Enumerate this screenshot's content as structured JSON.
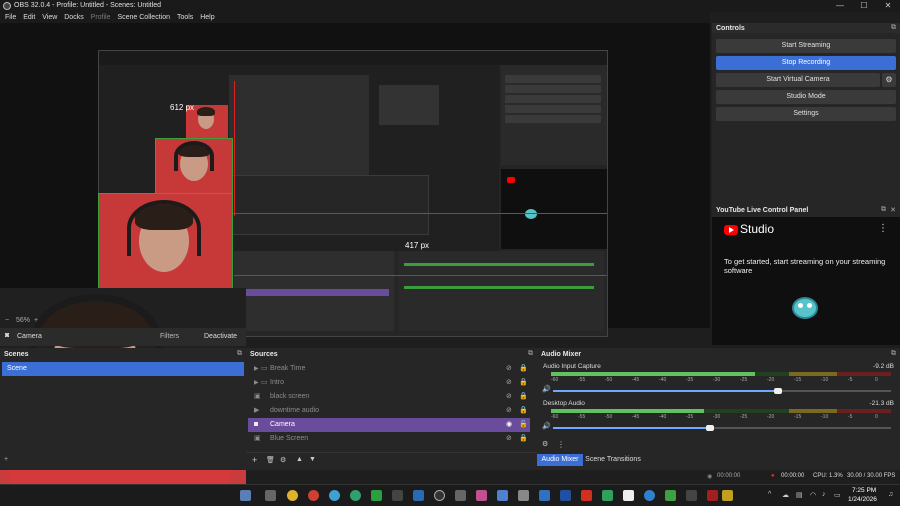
{
  "window": {
    "title": "OBS 32.0.4 - Profile: Untitled - Scenes: Untitled",
    "controls": [
      "—",
      "☐",
      "✕"
    ]
  },
  "menu": [
    "File",
    "Edit",
    "View",
    "Docks",
    "Profile",
    "Scene Collection",
    "Tools",
    "Help"
  ],
  "preview": {
    "size_label": "612 px",
    "size_label_2": "417 px",
    "zoom": "56%"
  },
  "controls_dock": {
    "title": "Controls",
    "start_streaming": "Start Streaming",
    "stop_recording": "Stop Recording",
    "start_virtual_camera": "Start Virtual Camera",
    "studio_mode": "Studio Mode",
    "settings": "Settings"
  },
  "youtube_dock": {
    "title": "YouTube Live Control Panel",
    "logo_text": "Studio",
    "message": "To get started, start streaming on your streaming software"
  },
  "source_toolbar": {
    "source_name": "Camera",
    "filters": "Filters",
    "deactivate": "Deactivate"
  },
  "scenes": {
    "title": "Scenes",
    "items": [
      {
        "label": "Scene"
      }
    ]
  },
  "sources": {
    "title": "Sources",
    "items": [
      {
        "label": "Break Time",
        "type": "group"
      },
      {
        "label": "Intro",
        "type": "group"
      },
      {
        "label": "black screen",
        "type": "image"
      },
      {
        "label": "downtime audio",
        "type": "media"
      },
      {
        "label": "Camera",
        "type": "camera",
        "selected": true
      },
      {
        "label": "Blue Screen",
        "type": "image"
      }
    ]
  },
  "mixer": {
    "title": "Audio Mixer",
    "channels": [
      {
        "name": "Audio Input Capture",
        "level": "-9.2 dB",
        "fader": 0.72
      },
      {
        "name": "Desktop Audio",
        "level": "-21.3 dB",
        "fader": 0.55
      }
    ],
    "ticks": [
      "-60",
      "-55",
      "-50",
      "-45",
      "-40",
      "-35",
      "-30",
      "-25",
      "-20",
      "-15",
      "-10",
      "-5",
      "0"
    ],
    "tabs": [
      "Audio Mixer",
      "Scene Transitions"
    ]
  },
  "status": {
    "stream_time": "00:00:00",
    "rec_time": "00:00:00",
    "cpu": "CPU: 1.3%",
    "fps": "30.00 / 30.00 FPS"
  },
  "taskbar": {
    "time": "7:25 PM",
    "date": "1/24/2026"
  },
  "colors": {
    "accent": "#3c6fd6",
    "selected_source": "#6a4c9c",
    "youtube_red": "#ff0000"
  }
}
